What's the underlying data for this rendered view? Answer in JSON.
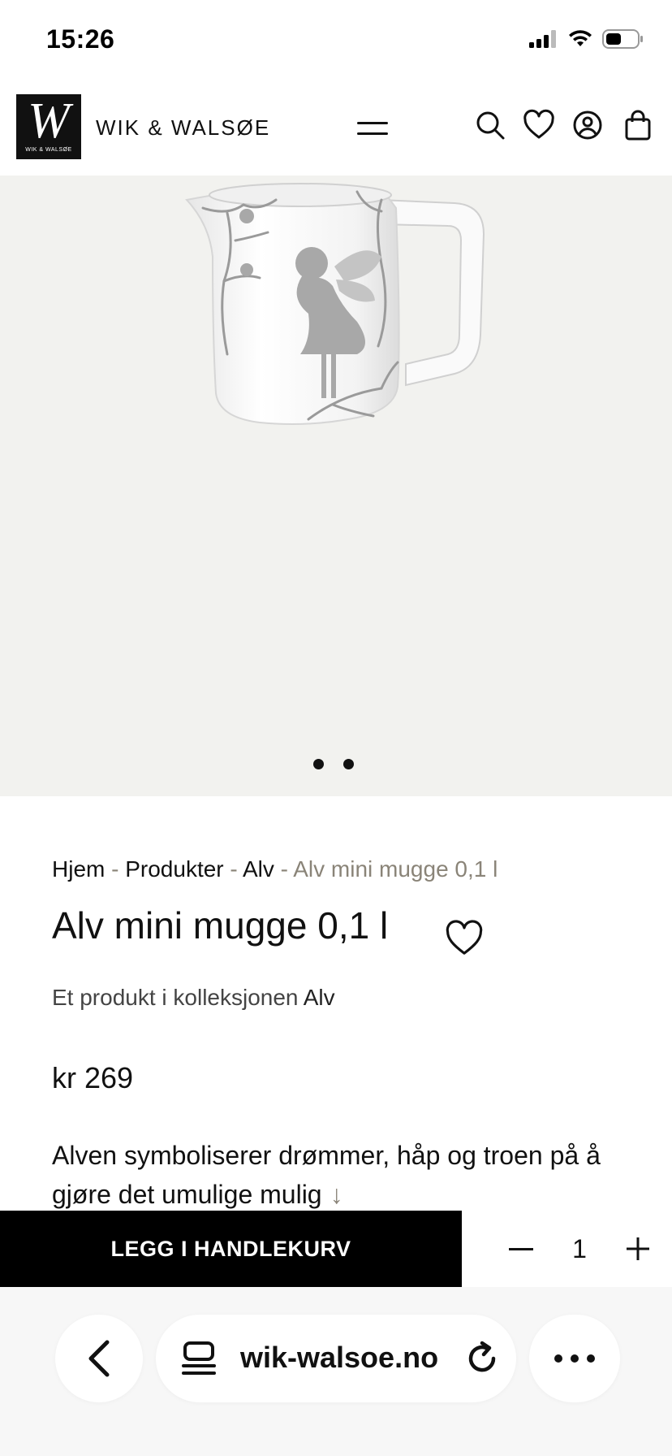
{
  "status_bar": {
    "time": "15:26"
  },
  "header": {
    "logo_letter": "W",
    "logo_small_text": "WIK & WALSØE",
    "brand_name": "WIK & WALSØE"
  },
  "gallery": {
    "slide_count": 2,
    "current_slide": 1
  },
  "breadcrumb": {
    "items": [
      "Hjem",
      "Produkter",
      "Alv"
    ],
    "current": "Alv mini mugge 0,1 l",
    "separator": "-"
  },
  "product": {
    "title": "Alv mini mugge 0,1 l",
    "collection_prefix": "Et produkt i kolleksjonen",
    "collection_name": "Alv",
    "price": "kr 269",
    "description": "Alven symboliserer drømmer, håp og troen på å gjøre det umulige mulig",
    "description_more_icon": "↓"
  },
  "cart": {
    "add_label": "LEGG I HANDLEKURV",
    "quantity": "1"
  },
  "browser": {
    "url": "wik-walsoe.no"
  },
  "colors": {
    "accent_muted": "#8a8478",
    "hero_background": "#f2f2ef",
    "button_background": "#000000"
  }
}
